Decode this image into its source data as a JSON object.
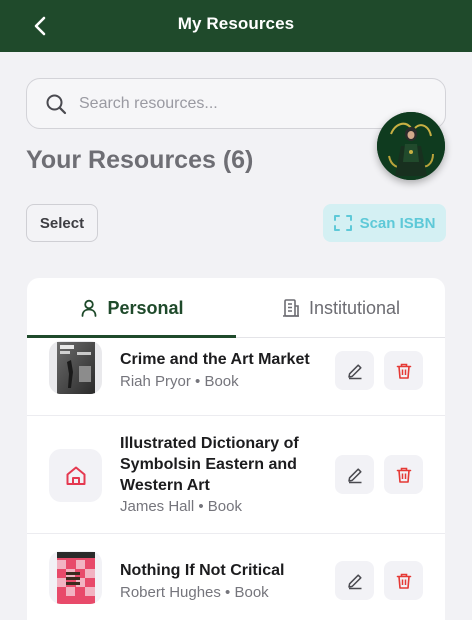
{
  "header": {
    "title": "My Resources"
  },
  "search": {
    "placeholder": "Search resources..."
  },
  "section": {
    "title": "Your Resources (6)"
  },
  "actions": {
    "select_label": "Select",
    "scan_label": "Scan ISBN"
  },
  "tabs": [
    {
      "label": "Personal",
      "active": true
    },
    {
      "label": "Institutional",
      "active": false
    }
  ],
  "resources": [
    {
      "title": "Crime and the Art Market",
      "author": "Riah Pryor",
      "type": "Book",
      "subtitle": "Riah Pryor • Book",
      "thumbnail": "book-cover-crime-art-market"
    },
    {
      "title": "Illustrated Dictionary of Symbolsin Eastern and Western Art",
      "author": "James Hall",
      "type": "Book",
      "subtitle": "James Hall • Book",
      "thumbnail": "home-icon"
    },
    {
      "title": "Nothing If Not Critical",
      "author": "Robert Hughes",
      "type": "Book",
      "subtitle": "Robert Hughes • Book",
      "thumbnail": "book-cover-nothing-if-not-critical"
    }
  ],
  "colors": {
    "header_bg": "#1f4a2b",
    "accent_green": "#1f4a2b",
    "scan_bg": "#d4f0f3",
    "scan_text": "#5ec9d8",
    "delete_red": "#e53935",
    "home_icon_red": "#e53950"
  }
}
